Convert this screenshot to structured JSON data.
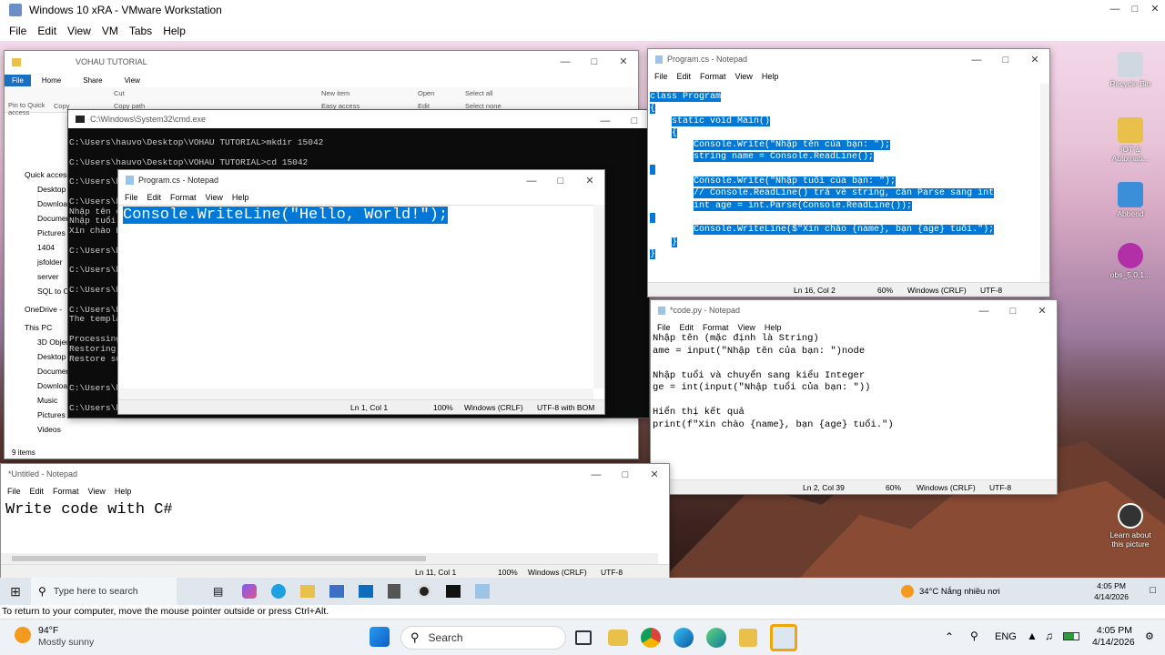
{
  "vmware": {
    "title": "Windows 10 xRA - VMware Workstation",
    "menu": [
      "File",
      "Edit",
      "View",
      "VM",
      "Tabs",
      "Help"
    ],
    "status_message": "To return to your computer, move the mouse pointer outside or press Ctrl+Alt."
  },
  "explorer": {
    "title": "VOHAU TUTORIAL",
    "ribbon_tabs": [
      "File",
      "Home",
      "Share",
      "View"
    ],
    "ribbon_items": [
      "Pin to Quick access",
      "Copy",
      "Cut",
      "Copy path",
      "New item",
      "Easy access",
      "Open",
      "Edit",
      "Select all",
      "Select none"
    ],
    "nav": [
      "Quick access",
      "Desktop",
      "Downloads",
      "Documents",
      "Pictures",
      "1404",
      "jsfolder",
      "server",
      "SQL to Oc",
      "OneDrive -",
      "This PC",
      "3D Objects",
      "Desktop",
      "Documents",
      "Downloads",
      "Music",
      "Pictures",
      "Videos"
    ],
    "item_count": "9 items"
  },
  "cmd": {
    "title": "C:\\Windows\\System32\\cmd.exe",
    "lines": [
      "C:\\Users\\hauvo\\Desktop\\VOHAU TUTORIAL>mkdir 15042",
      "",
      "C:\\Users\\hauvo\\Desktop\\VOHAU TUTORIAL>cd 15042",
      "",
      "C:\\Users\\h",
      "",
      "C:\\Users\\h",
      "Nhập tên c",
      "Nhập tuổi",
      "Xin chào P",
      "",
      "C:\\Users\\h",
      "",
      "C:\\Users\\h",
      "",
      "C:\\Users\\h",
      "",
      "C:\\Users\\h",
      "The templa",
      "",
      "Processing",
      "Restoring",
      "Restore su",
      "",
      "",
      "C:\\Users\\h",
      "",
      "C:\\Users\\hauvo\\Desktop\\VOHAU TUTORIAL\\15042>"
    ]
  },
  "notepad_main": {
    "title": "Program.cs - Notepad",
    "menu": [
      "File",
      "Edit",
      "Format",
      "View",
      "Help"
    ],
    "content": "Console.WriteLine(\"Hello, World!\");",
    "status": {
      "pos": "Ln 1, Col 1",
      "zoom": "100%",
      "eol": "Windows (CRLF)",
      "enc": "UTF-8 with BOM"
    }
  },
  "notepad_right": {
    "title": "Program.cs - Notepad",
    "menu": [
      "File",
      "Edit",
      "Format",
      "View",
      "Help"
    ],
    "lines": [
      "class Program",
      "{",
      "    static void Main()",
      "    {",
      "        Console.Write(\"Nhập tên của bạn: \");",
      "        string name = Console.ReadLine();",
      "",
      "        Console.Write(\"Nhập tuổi của bạn: \");",
      "        // Console.ReadLine() trả về string, cần Parse sang int",
      "        int age = int.Parse(Console.ReadLine());",
      "",
      "        Console.WriteLine($\"Xin chào {name}, bạn {age} tuổi.\");",
      "    }",
      "}"
    ],
    "status": {
      "pos": "Ln 16, Col 2",
      "zoom": "60%",
      "eol": "Windows (CRLF)",
      "enc": "UTF-8"
    }
  },
  "notepad_py": {
    "title": "*code.py - Notepad",
    "menu": [
      "File",
      "Edit",
      "Format",
      "View",
      "Help"
    ],
    "lines": [
      "Nhập tên (mặc định là String)",
      "ame = input(\"Nhập tên của bạn: \")node",
      "",
      "Nhập tuổi và chuyển sang kiểu Integer",
      "ge = int(input(\"Nhập tuổi của bạn: \"))",
      "",
      "Hiển thị kết quả",
      "print(f\"Xin chào {name}, bạn {age} tuổi.\")"
    ],
    "status": {
      "pos": "Ln 2, Col 39",
      "zoom": "60%",
      "eol": "Windows (CRLF)",
      "enc": "UTF-8"
    }
  },
  "notepad_untitled": {
    "title": "*Untitled - Notepad",
    "menu": [
      "File",
      "Edit",
      "Format",
      "View",
      "Help"
    ],
    "content": "Write code with C#",
    "status": {
      "pos": "Ln 11, Col 1",
      "zoom": "100%",
      "eol": "Windows (CRLF)",
      "enc": "UTF-8"
    }
  },
  "desktop_icons": [
    {
      "label": "Recycle Bin",
      "icon": "recycle-bin-icon",
      "color": "#cfd8e0"
    },
    {
      "label": "IOT & Automati...",
      "icon": "folder-icon",
      "color": "#e8c04a"
    },
    {
      "label": "Abbend",
      "icon": "app-icon",
      "color": "#3b8fd9"
    },
    {
      "label": "obs_5.0.1...",
      "icon": "obs-icon",
      "color": "#b22fa8"
    },
    {
      "label": "Learn about this picture",
      "icon": "camera-icon",
      "color": "#333333"
    }
  ],
  "guest_taskbar": {
    "search_placeholder": "Type here to search",
    "weather": "34°C  Nắng nhiều nơi",
    "time": "4:05 PM",
    "date": "4/14/2026"
  },
  "host_taskbar": {
    "weather_temp": "94°F",
    "weather_desc": "Mostly sunny",
    "search_label": "Search",
    "lang": "ENG",
    "time": "4:05 PM",
    "date": "4/14/2026"
  }
}
